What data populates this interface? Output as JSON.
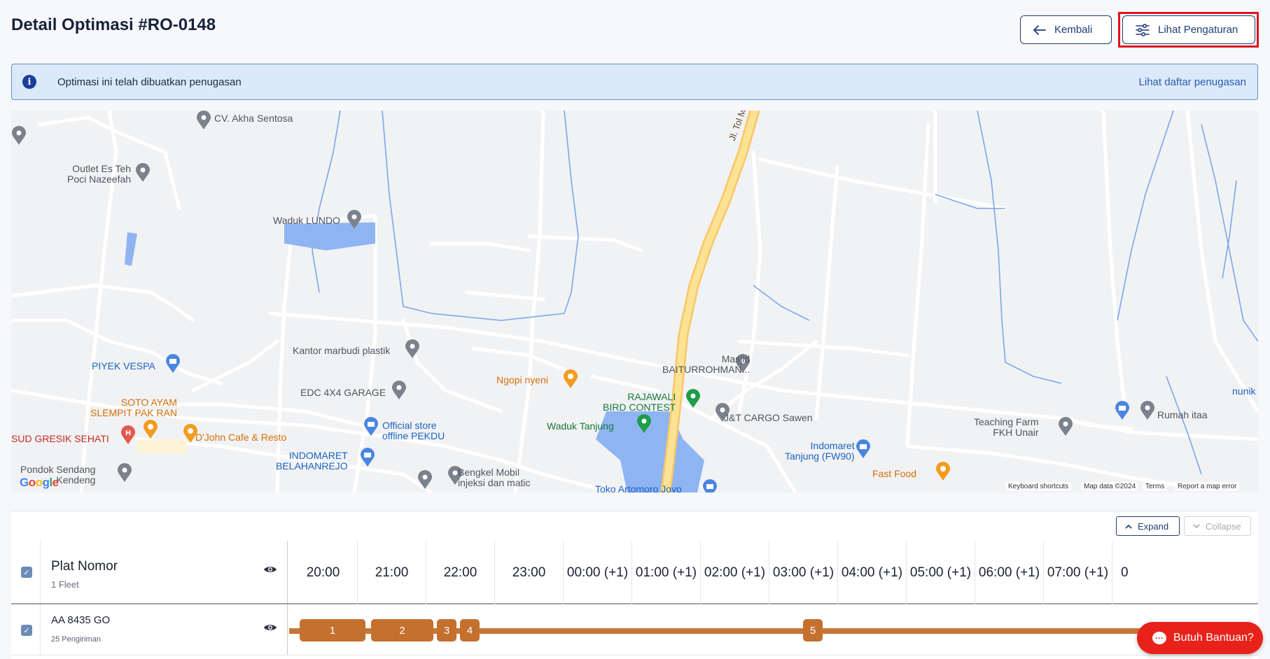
{
  "header": {
    "title": "Detail Optimasi #RO-0148",
    "back_label": "Kembali",
    "settings_label": "Lihat Pengaturan"
  },
  "banner": {
    "message": "Optimasi ini telah dibuatkan penugasan",
    "link": "Lihat daftar penugasan"
  },
  "map": {
    "labels": {
      "cv_akha": "CV. Akha Sentosa",
      "outlet_es_teh": "Outlet Es Teh\nPoci Nazeefah",
      "waduk_lundo": "Waduk LUNDO",
      "jl_tol": "Jl. Tol Manyar",
      "kantor_marbudi": "Kantor marbudi plastik",
      "piyek_vespa": "PIYEK VESPA",
      "edc_garage": "EDC 4X4 GARAGE",
      "ngopi_nyeni": "Ngopi nyeni",
      "masjid": "Masjid\nBAITURROHMAN...",
      "rajawali": "RAJAWALI\nBIRD CONTEST",
      "soto_ayam": "SOTO AYAM\nSLEMPIT PAK RAN",
      "sud_gresik": "SUD GRESIK SEHATI",
      "djohn": "D'John Cafe & Resto",
      "official_store": "Official store\noffline PEKDU",
      "waduk_tanjung": "Waduk Tanjung",
      "jt_cargo": "J&T CARGO Sawen",
      "teaching_farm": "Teaching Farm\nFKH Unair",
      "rumah_itaa": "Rumah itaa",
      "nunik": "nunik",
      "indomaret_bel": "INDOMARET\nBELAHANREJO",
      "indomaret_tanjung": "Indomaret\nTanjung (FW90)",
      "pondok_sendang": "Pondok Sendang\nKendeng",
      "bengkel": "Bengkel Mobil\ninjeksi dan matic",
      "fast_food": "Fast Food",
      "toko_artomoro": "Toko Artomoro Joyo"
    },
    "google_logo": "Google",
    "footer": {
      "shortcuts": "Keyboard shortcuts",
      "data": "Map data ©2024",
      "terms": "Terms",
      "report": "Report a map error"
    }
  },
  "panel": {
    "expand_label": "Expand",
    "collapse_label": "Collapse",
    "header": {
      "title": "Plat Nomor",
      "subtitle": "1 Fleet"
    },
    "time_slots": [
      "20:00",
      "21:00",
      "22:00",
      "23:00",
      "00:00 (+1)",
      "01:00 (+1)",
      "02:00 (+1)",
      "03:00 (+1)",
      "04:00 (+1)",
      "05:00 (+1)",
      "06:00 (+1)",
      "07:00 (+1)",
      "0"
    ],
    "rows": [
      {
        "plate": "AA 8435 GO",
        "subtitle": "25 Pengiriman",
        "segments": [
          "1",
          "2",
          "3",
          "4",
          "5"
        ]
      }
    ]
  },
  "help_label": "Butuh Bantuan?",
  "colors": {
    "primary": "#1f3b78",
    "highlight_border": "#e1141c",
    "banner_bg": "#dbe9fb",
    "route": "#c4702f",
    "help": "#e8221b"
  }
}
